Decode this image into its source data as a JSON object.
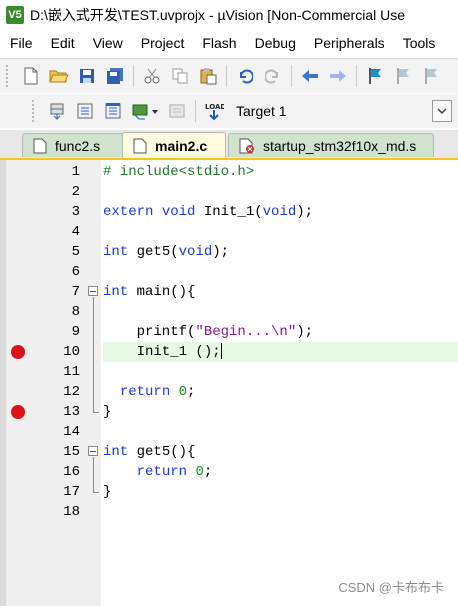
{
  "window": {
    "app_icon": "V5",
    "title": "D:\\嵌入式开发\\TEST.uvprojx - µVision  [Non-Commercial Use"
  },
  "menu": [
    "File",
    "Edit",
    "View",
    "Project",
    "Flash",
    "Debug",
    "Peripherals",
    "Tools"
  ],
  "toolbar2": {
    "load_label": "LOAD",
    "target": "Target 1"
  },
  "tabs": [
    {
      "label": "func2.s",
      "active": false
    },
    {
      "label": "main2.c",
      "active": true
    },
    {
      "label": "startup_stm32f10x_md.s",
      "active": false
    }
  ],
  "editor": {
    "lines": [
      {
        "n": "1",
        "code": [
          {
            "t": "# include<stdio.h>",
            "c": "pp"
          }
        ]
      },
      {
        "n": "2",
        "code": []
      },
      {
        "n": "3",
        "code": [
          {
            "t": "extern",
            "c": "kw"
          },
          {
            "t": " "
          },
          {
            "t": "void",
            "c": "kw"
          },
          {
            "t": " Init_1("
          },
          {
            "t": "void",
            "c": "kw"
          },
          {
            "t": ");"
          }
        ]
      },
      {
        "n": "4",
        "code": []
      },
      {
        "n": "5",
        "code": [
          {
            "t": "int",
            "c": "kw"
          },
          {
            "t": " get5("
          },
          {
            "t": "void",
            "c": "kw"
          },
          {
            "t": ");"
          }
        ]
      },
      {
        "n": "6",
        "code": []
      },
      {
        "n": "7",
        "code": [
          {
            "t": "int",
            "c": "kw"
          },
          {
            "t": " main(){"
          }
        ]
      },
      {
        "n": "8",
        "code": []
      },
      {
        "n": "9",
        "code": [
          {
            "t": "    printf("
          },
          {
            "t": "\"Begin...\\n\"",
            "c": "str"
          },
          {
            "t": ");"
          }
        ]
      },
      {
        "n": "10",
        "code": [
          {
            "t": "    Init_1 ();"
          }
        ]
      },
      {
        "n": "11",
        "code": []
      },
      {
        "n": "12",
        "code": [
          {
            "t": "  "
          },
          {
            "t": "return",
            "c": "kw"
          },
          {
            "t": " "
          },
          {
            "t": "0",
            "c": "num"
          },
          {
            "t": ";"
          }
        ]
      },
      {
        "n": "13",
        "code": [
          {
            "t": "}"
          }
        ]
      },
      {
        "n": "14",
        "code": []
      },
      {
        "n": "15",
        "code": [
          {
            "t": "int",
            "c": "kw"
          },
          {
            "t": " get5(){"
          }
        ]
      },
      {
        "n": "16",
        "code": [
          {
            "t": "    "
          },
          {
            "t": "return",
            "c": "kw"
          },
          {
            "t": " "
          },
          {
            "t": "0",
            "c": "num"
          },
          {
            "t": ";"
          }
        ]
      },
      {
        "n": "17",
        "code": [
          {
            "t": "}"
          }
        ]
      },
      {
        "n": "18",
        "code": []
      }
    ],
    "breakpoint_lines": [
      "10",
      "13"
    ],
    "current_line": "10",
    "fold_lines": [
      "7",
      "15"
    ]
  },
  "watermark": "CSDN @卡布布卡"
}
